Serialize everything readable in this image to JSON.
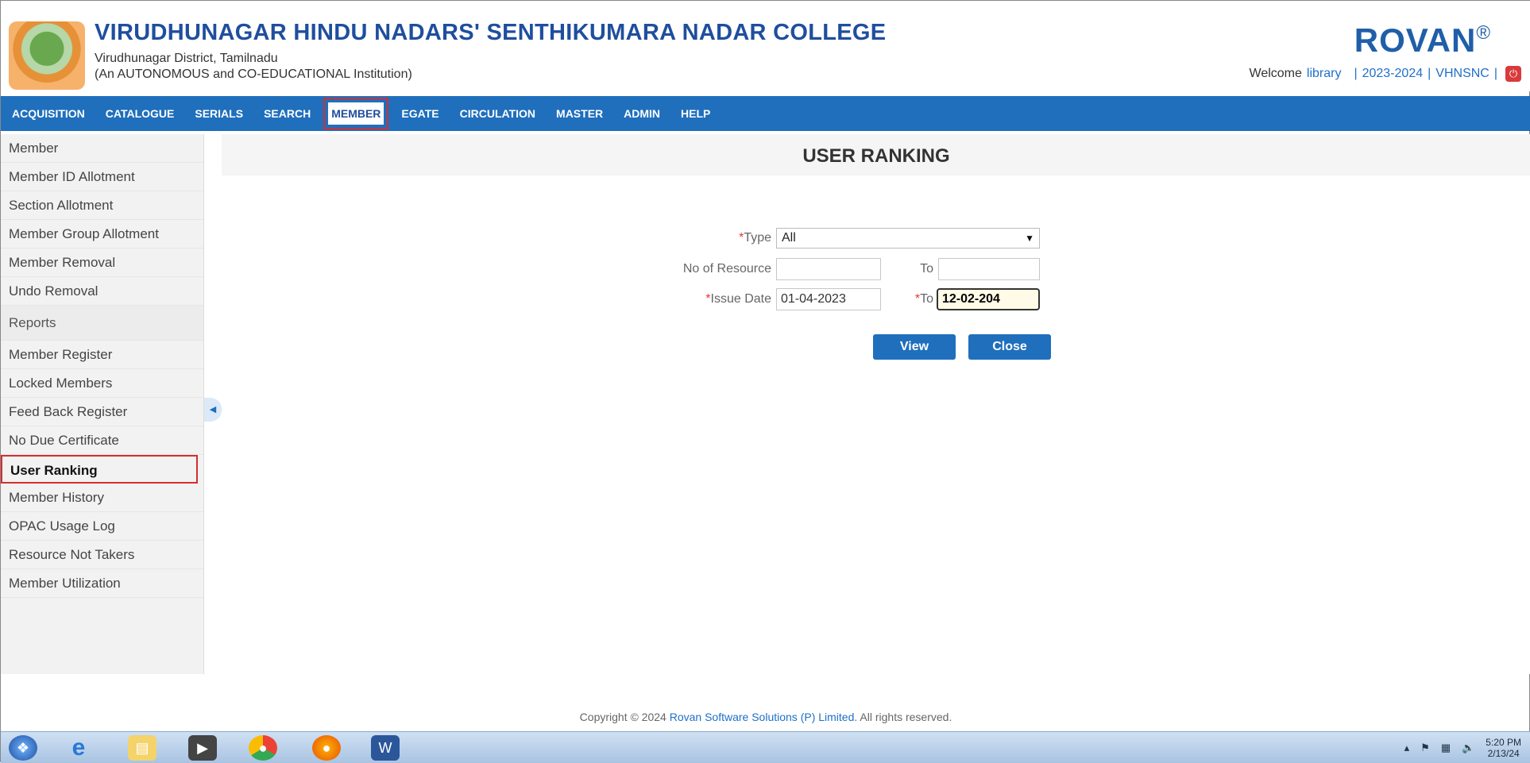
{
  "header": {
    "college": "VIRUDHUNAGAR HINDU NADARS' SENTHIKUMARA NADAR COLLEGE",
    "district": "Virudhunagar District, Tamilnadu",
    "institution": "(An AUTONOMOUS and CO-EDUCATIONAL Institution)",
    "brand": "ROVAN",
    "brand_mark": "®",
    "welcome": "Welcome",
    "user": "library",
    "year": "2023-2024",
    "code": "VHNSNC",
    "sep": "|"
  },
  "nav": [
    "ACQUISITION",
    "CATALOGUE",
    "SERIALS",
    "SEARCH",
    "MEMBER",
    "EGATE",
    "CIRCULATION",
    "MASTER",
    "ADMIN",
    "HELP"
  ],
  "sidebar": {
    "items": [
      "Member",
      "Member ID Allotment",
      "Section Allotment",
      "Member Group Allotment",
      "Member Removal",
      "Undo Removal"
    ],
    "section": "Reports",
    "reports": [
      "Member Register",
      "Locked Members",
      "Feed Back Register",
      "No Due Certificate",
      "User Ranking",
      "Member History",
      "OPAC Usage Log",
      "Resource Not Takers",
      "Member Utilization"
    ]
  },
  "page": {
    "title": "USER RANKING",
    "type_label": "Type",
    "type_value": "All",
    "resource_label": "No of Resource",
    "to_label": "To",
    "issue_label": "Issue Date",
    "issue_from": "01-04-2023",
    "issue_to": "12-02-204",
    "required_mark": "*",
    "view": "View",
    "close": "Close"
  },
  "footer": {
    "pre": "Copyright © 2024 ",
    "company": "Rovan Software Solutions (P) Limited",
    "post": ". All rights reserved."
  },
  "taskbar": {
    "time": "5:20 PM",
    "date": "2/13/24"
  },
  "colors": {
    "nav": "#1f6fbd",
    "brand": "#1f5fa8",
    "highlight": "#d32f2f"
  }
}
